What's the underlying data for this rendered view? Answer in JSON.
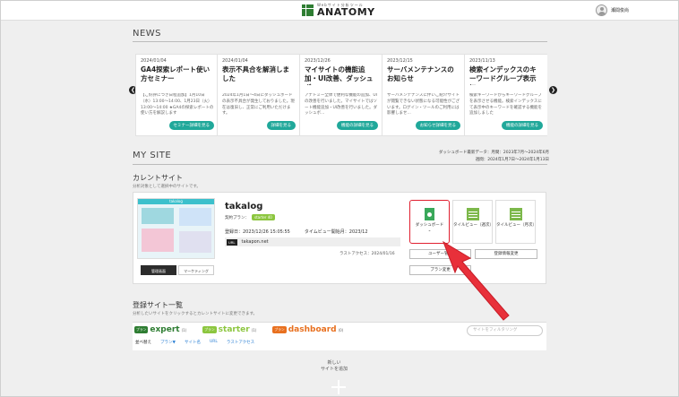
{
  "header": {
    "logo_sub": "Webサイト分析ツール",
    "logo_main": "ANATOMY",
    "user_name": "瀬間俊尚"
  },
  "news": {
    "heading": "NEWS",
    "items": [
      {
        "date": "2024/01/04",
        "title": "GA4探索レポート使い方セミナー",
        "body": "【ご好評につき日程追加】1月10日（水）13:00〜14:00、1月23日（火）13:00〜14:00 ★GA4の探索レポートの使い方を解説します",
        "button": "セミナー詳細を見る"
      },
      {
        "date": "2024/01/04",
        "title": "表示不具合を解消しました",
        "body": "2024年1月1日～4日にダッシュボードの表示不具合が発生しておりました。現在は復旧し、正常にご利用いただけます。",
        "button": "詳細を見る"
      },
      {
        "date": "2023/12/26",
        "title": "マイサイトの機能追加・UI改善、ダッシュボ…",
        "body": "アナトミー全体で便利な機能の追加、UIの改善を行いました。マイサイトではソート機能追加・UI改善を行いました。ダッシュボ…",
        "button": "機能の詳細を見る"
      },
      {
        "date": "2023/12/15",
        "title": "サーバメンテナンスのお知らせ",
        "body": "サーバメンテナンスに伴いご紹介サイトが閲覧できない状態になる可能性がございます。ログイン・ツールのご利用には影響しませ…",
        "button": "お知らせ詳細を見る"
      },
      {
        "date": "2023/11/13",
        "title": "検索インデックスのキーワードグループ表示に…",
        "body": "検索キーワードからキーワードグループを表示させる機能。検索インデックスにて表示中のキーワードを確認する機能を追加しました",
        "button": "機能の詳細を見る"
      }
    ]
  },
  "mysite": {
    "heading": "MY SITE",
    "update_label": "ダッシュボード最新データ：月間：2023年7月〜2024年6月",
    "update_label2": "週間：2024年1月7日〜2024年1月13日",
    "current_title": "カレントサイト",
    "current_sub": "分析対象として選択中のサイトです。",
    "site_name": "takalog",
    "plan_label": "契約プラン：",
    "plan_badge": "starter 40",
    "registered": "登録日：2023/12/26 15:05:55",
    "pageview_start": "タイムビュー開始月：2023/12",
    "url_tag": "URL",
    "url": "takapon.net",
    "last_access": "ラストアクセス：2024/01/16",
    "thumb_title": "takalog",
    "btn_manage": "管理画面",
    "btn_marketing": "マーケティング",
    "tiles": [
      {
        "label": "ダッシュボード"
      },
      {
        "label": "タイルビュー（週次）"
      },
      {
        "label": "タイルビュー（月次）"
      }
    ],
    "tile_chevron": "⌄",
    "user_manage": "ユーザー管理",
    "reg_change": "登録情報変更",
    "plan_change": "プラン変更"
  },
  "registered": {
    "title": "登録サイト一覧",
    "sub": "分析したいサイトをクリックするとカレントサイトに変更できます。",
    "tabs": [
      {
        "badge": "プラン",
        "name": "expert",
        "count": "(1)",
        "color": "#2e7d32"
      },
      {
        "badge": "プラン",
        "name": "starter",
        "count": "(1)",
        "color": "#8cc63f"
      },
      {
        "badge": "プラン",
        "name": "dashboard",
        "count": "(0)",
        "color": "#e8701f"
      }
    ],
    "sort_label": "並べ替え",
    "sort_items": [
      "プラン▼",
      "サイト名",
      "URL",
      "ラストアクセス"
    ],
    "search_placeholder": "サイトをフィルタリング",
    "add_site": "新しい\nサイトを追加"
  }
}
